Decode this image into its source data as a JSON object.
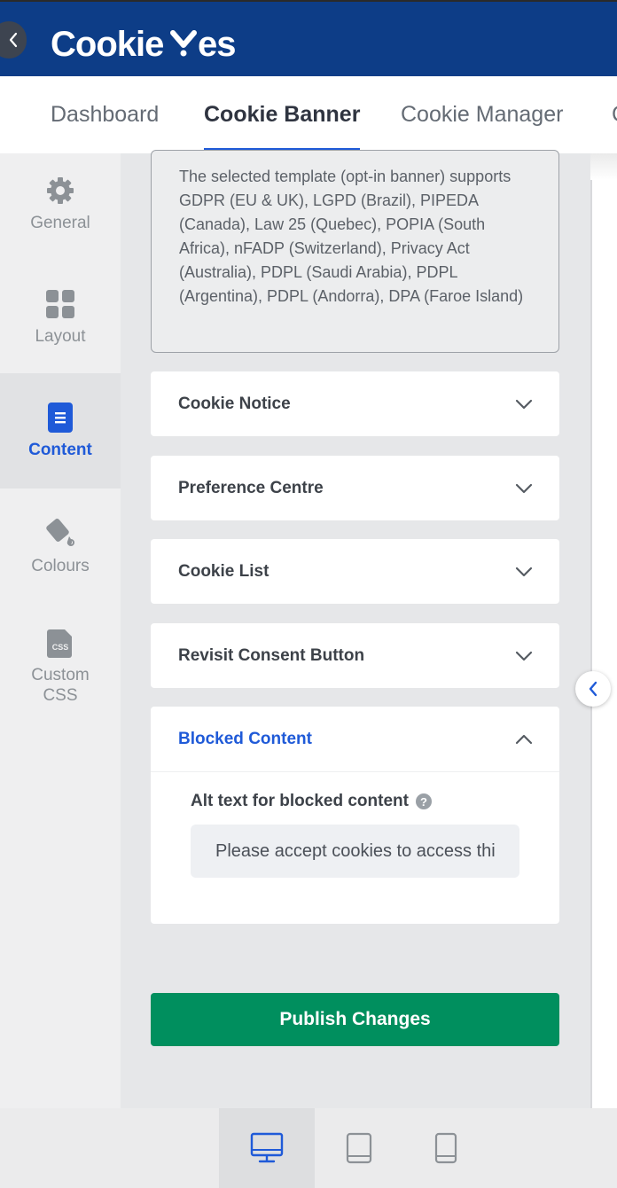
{
  "header": {
    "logo_text": "CookieYes",
    "back_icon": "chevron-left-icon",
    "brand_color": "#0d3d87"
  },
  "tabs": [
    {
      "label": "Dashboard",
      "active": false
    },
    {
      "label": "Cookie Banner",
      "active": true
    },
    {
      "label": "Cookie Manager",
      "active": false
    }
  ],
  "sidebar": {
    "items": [
      {
        "label": "General",
        "icon": "gear-icon",
        "active": false
      },
      {
        "label": "Layout",
        "icon": "grid-icon",
        "active": false
      },
      {
        "label": "Content",
        "icon": "document-icon",
        "active": true
      },
      {
        "label": "Colours",
        "icon": "paint-bucket-icon",
        "active": false
      },
      {
        "label": "Custom CSS",
        "icon": "css-file-icon",
        "active": false
      }
    ]
  },
  "main": {
    "template_info": "The selected template (opt-in banner) supports GDPR (EU & UK), LGPD (Brazil), PIPEDA (Canada), Law 25 (Quebec), POPIA (South Africa), nFADP (Switzerland), Privacy Act (Australia), PDPL (Saudi Arabia), PDPL (Argentina), PDPL (Andorra), DPA (Faroe Island)",
    "sections": [
      {
        "title": "Cookie Notice",
        "expanded": false
      },
      {
        "title": "Preference Centre",
        "expanded": false
      },
      {
        "title": "Cookie List",
        "expanded": false
      },
      {
        "title": "Revisit Consent Button",
        "expanded": false
      },
      {
        "title": "Blocked Content",
        "expanded": true
      }
    ],
    "blocked_content": {
      "field_label": "Alt text for blocked content",
      "help_icon": "?",
      "field_value": "Please accept cookies to access this content"
    },
    "publish_label": "Publish Changes",
    "publish_color": "#008f5e",
    "accent_color": "#1f5ad8"
  },
  "device_bar": {
    "items": [
      {
        "icon": "desktop-icon",
        "active": true
      },
      {
        "icon": "tablet-icon",
        "active": false
      },
      {
        "icon": "mobile-icon",
        "active": false
      }
    ]
  }
}
